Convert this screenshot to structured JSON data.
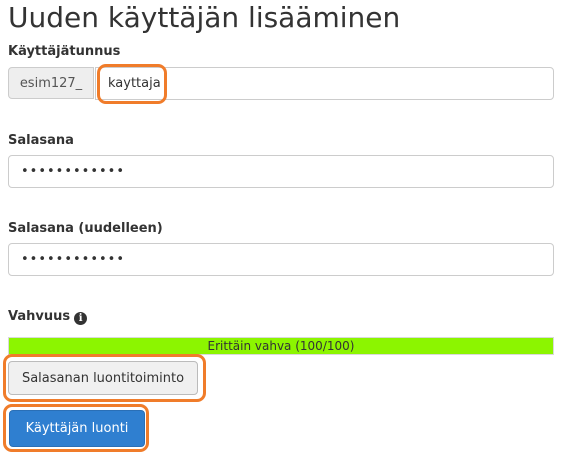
{
  "page": {
    "title": "Uuden käyttäjän lisääminen"
  },
  "username": {
    "label": "Käyttäjätunnus",
    "prefix": "esim127_",
    "value": "kayttaja"
  },
  "password": {
    "label": "Salasana",
    "value": "••••••••••••"
  },
  "password_repeat": {
    "label": "Salasana (uudelleen)",
    "value": "••••••••••••"
  },
  "strength": {
    "label": "Vahvuus",
    "info_icon": "info-circle-icon",
    "text": "Erittäin vahva (100/100)",
    "level": 1.0,
    "color": "#8cf500"
  },
  "buttons": {
    "generator_label": "Salasanan luontitoiminto",
    "create_label": "Käyttäjän luonti",
    "create_color": "#2f7fd0"
  },
  "annotation_color": "#f07c2a"
}
